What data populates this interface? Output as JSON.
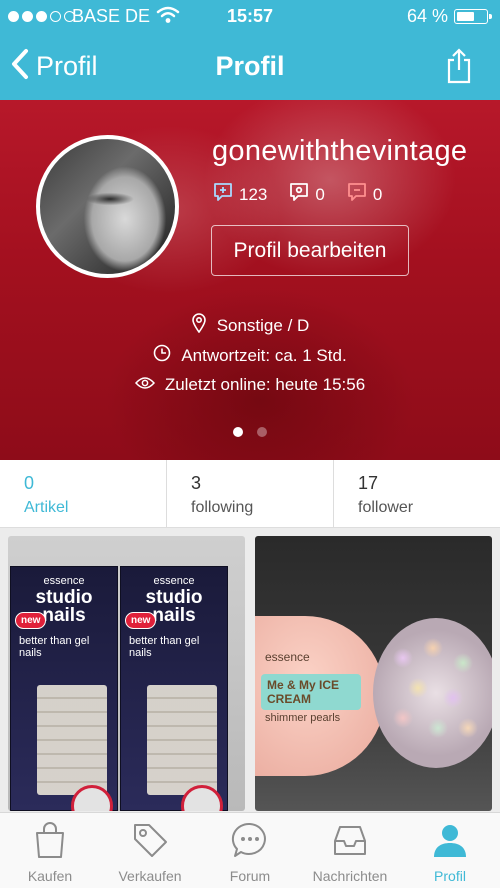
{
  "status": {
    "carrier": "BASE DE",
    "time": "15:57",
    "battery": "64 %",
    "battery_level": 0.64,
    "signal_bars": 3
  },
  "nav": {
    "back_label": "Profil",
    "title": "Profil"
  },
  "profile": {
    "username": "gonewiththevintage",
    "stats": [
      {
        "icon": "comment-plus-icon",
        "value": "123",
        "color": "#a8d9ff"
      },
      {
        "icon": "comment-neutral-icon",
        "value": "0",
        "color": "#ffffff"
      },
      {
        "icon": "comment-minus-icon",
        "value": "0",
        "color": "#ff8f8f"
      }
    ],
    "edit_button": "Profil bearbeiten",
    "location": "Sonstige / D",
    "response_time": "Antwortzeit: ca. 1 Std.",
    "last_online": "Zuletzt online: heute 15:56",
    "carousel_pages": 2,
    "carousel_active": 0
  },
  "counts": [
    {
      "num": "0",
      "label": "Artikel",
      "active": true
    },
    {
      "num": "3",
      "label": "following",
      "active": false
    },
    {
      "num": "17",
      "label": "follower",
      "active": false
    }
  ],
  "products": {
    "item1": {
      "brand": "essence",
      "name_line1": "studio",
      "name_line2": "nails",
      "new": "new",
      "tagline": "better than gel nails"
    },
    "item2": {
      "brand": "essence",
      "name": "Me & My ICE CREAM",
      "sub": "shimmer pearls"
    }
  },
  "tabs": [
    {
      "label": "Kaufen",
      "icon": "bag-icon"
    },
    {
      "label": "Verkaufen",
      "icon": "tag-icon"
    },
    {
      "label": "Forum",
      "icon": "chat-icon"
    },
    {
      "label": "Nachrichten",
      "icon": "inbox-icon"
    },
    {
      "label": "Profil",
      "icon": "person-icon",
      "active": true
    }
  ],
  "colors": {
    "accent": "#3fb9d6",
    "hero": "#a3101f"
  }
}
